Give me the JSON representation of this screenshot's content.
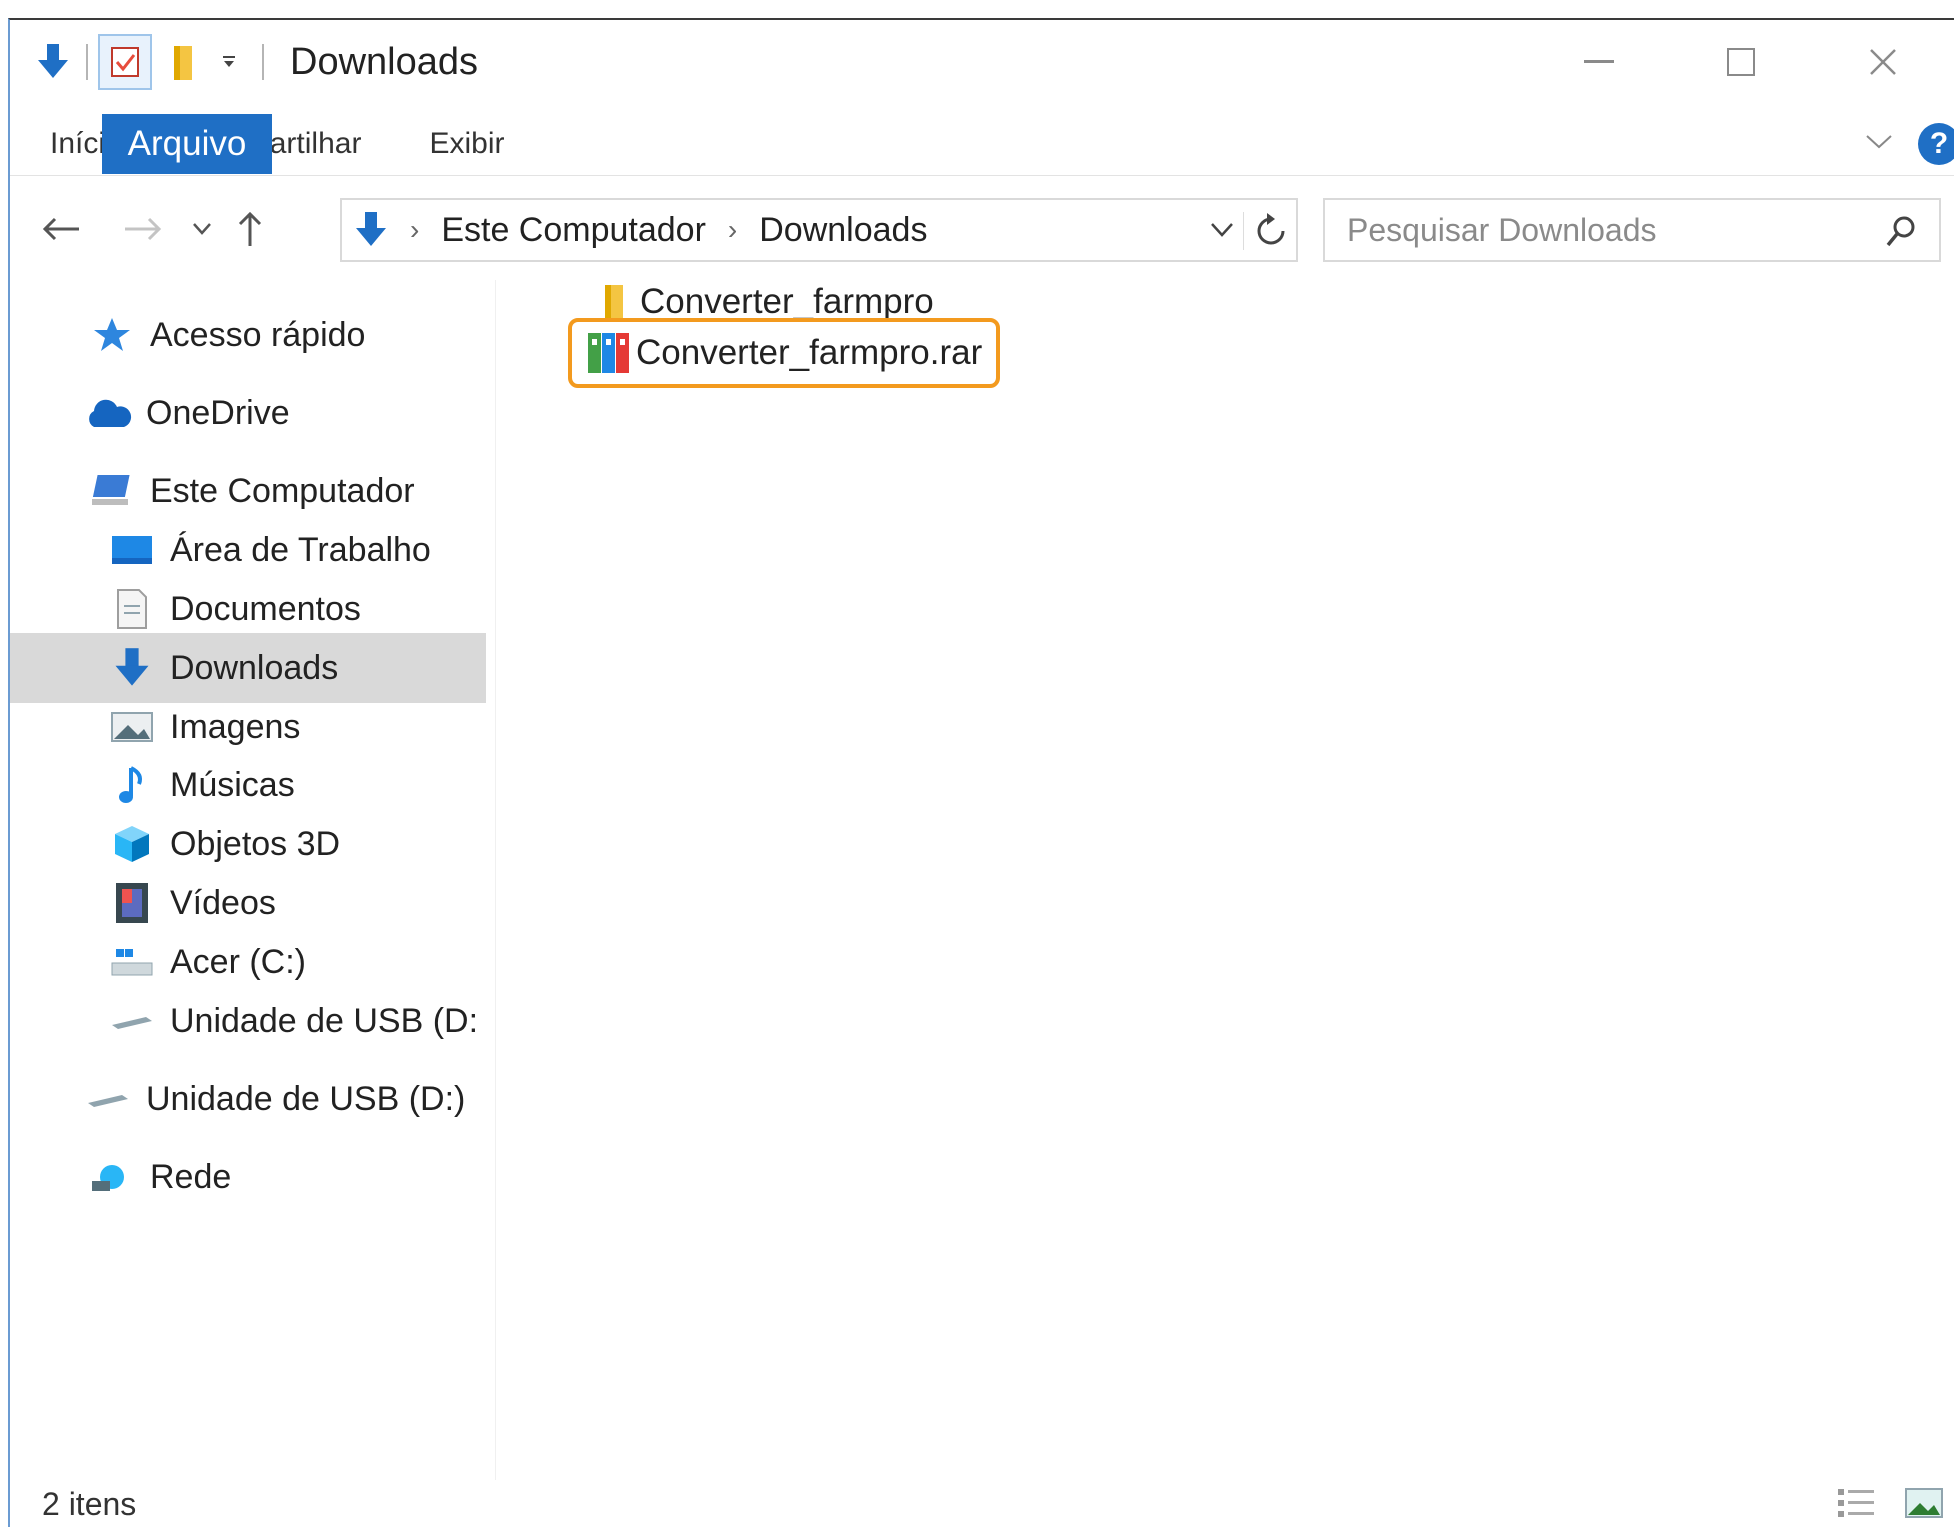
{
  "window": {
    "title": "Downloads"
  },
  "ribbon": {
    "tabs": [
      "Arquivo",
      "Início",
      "Compartilhar",
      "Exibir"
    ]
  },
  "address": {
    "crumbs": [
      "Este Computador",
      "Downloads"
    ]
  },
  "search": {
    "placeholder": "Pesquisar Downloads"
  },
  "sidebar": {
    "items": [
      {
        "label": "Acesso rápido",
        "icon": "star-icon"
      },
      {
        "label": "OneDrive",
        "icon": "cloud-icon"
      },
      {
        "label": "Este Computador",
        "icon": "computer-icon"
      },
      {
        "label": "Área de Trabalho",
        "icon": "desktop-icon"
      },
      {
        "label": "Documentos",
        "icon": "document-icon"
      },
      {
        "label": "Downloads",
        "icon": "download-icon"
      },
      {
        "label": "Imagens",
        "icon": "image-icon"
      },
      {
        "label": "Músicas",
        "icon": "music-icon"
      },
      {
        "label": "Objetos 3D",
        "icon": "cube-icon"
      },
      {
        "label": "Vídeos",
        "icon": "video-icon"
      },
      {
        "label": "Acer (C:)",
        "icon": "drive-icon"
      },
      {
        "label": "Unidade de USB (D:",
        "icon": "usb-drive-icon"
      },
      {
        "label": "Unidade de USB (D:)",
        "icon": "usb-drive-icon"
      },
      {
        "label": "Rede",
        "icon": "network-icon"
      }
    ],
    "selected": "Downloads"
  },
  "files": [
    {
      "name": "Converter_farmpro",
      "type": "folder"
    },
    {
      "name": "Converter_farmpro.rar",
      "type": "rar-archive",
      "highlighted": true
    }
  ],
  "status": {
    "count_text": "2 itens"
  },
  "colors": {
    "accent": "#1f6fc5",
    "highlight": "#f39a1e",
    "selected_bg": "#d9d9d9"
  }
}
